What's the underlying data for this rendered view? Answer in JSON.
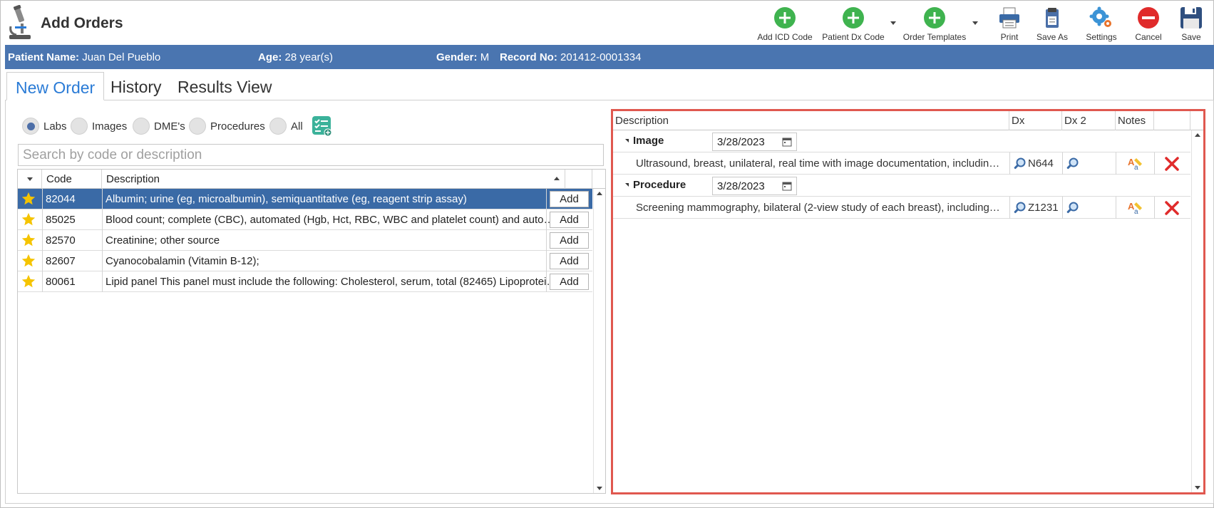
{
  "app": {
    "title": "Add Orders"
  },
  "toolbar": {
    "add_icd_code": "Add ICD Code",
    "patient_dx_code": "Patient Dx Code",
    "order_templates": "Order Templates",
    "print": "Print",
    "save_as": "Save As",
    "settings": "Settings",
    "cancel": "Cancel",
    "save": "Save"
  },
  "patient": {
    "name_label": "Patient Name:",
    "name": "Juan Del Pueblo",
    "age_label": "Age:",
    "age": "28 year(s)",
    "gender_label": "Gender:",
    "gender": "M",
    "record_label": "Record No:",
    "record": "201412-0001334"
  },
  "tabs": [
    {
      "label": "New Order",
      "active": true
    },
    {
      "label": "History",
      "active": false
    },
    {
      "label": "Results View",
      "active": false
    }
  ],
  "filters": [
    {
      "label": "Labs",
      "checked": true
    },
    {
      "label": "Images",
      "checked": false
    },
    {
      "label": "DME's",
      "checked": false
    },
    {
      "label": "Procedures",
      "checked": false
    },
    {
      "label": "All",
      "checked": false
    }
  ],
  "search": {
    "placeholder": "Search by code or description",
    "value": ""
  },
  "catalog": {
    "columns": [
      "Code",
      "Description"
    ],
    "add_label": "Add",
    "rows": [
      {
        "code": "82044",
        "desc": "Albumin; urine (eg, microalbumin), semiquantitative (eg, reagent strip assay)",
        "selected": true
      },
      {
        "code": "85025",
        "desc": "Blood count; complete (CBC), automated (Hgb, Hct, RBC, WBC and platelet count) and automated differential WBC count",
        "selected": false
      },
      {
        "code": "82570",
        "desc": "Creatinine; other source",
        "selected": false
      },
      {
        "code": "82607",
        "desc": "Cyanocobalamin (Vitamin B-12);",
        "selected": false
      },
      {
        "code": "80061",
        "desc": "Lipid panel This panel must include the following: Cholesterol, serum, total (82465) Lipoprotein, direct measurement",
        "selected": false
      }
    ]
  },
  "orders": {
    "columns": [
      "Description",
      "Dx",
      "Dx 2",
      "Notes"
    ],
    "groups": [
      {
        "name": "Image",
        "date": "3/28/2023",
        "items": [
          {
            "desc": "Ultrasound, breast, unilateral, real time with image documentation, including axilla when performed; complete",
            "dx": "N644",
            "dx2": ""
          }
        ]
      },
      {
        "name": "Procedure",
        "date": "3/28/2023",
        "items": [
          {
            "desc": "Screening mammography, bilateral (2-view study of each breast), including computer-aided detection (CAD) when performed",
            "dx": "Z1231",
            "dx2": ""
          }
        ]
      }
    ]
  },
  "colors": {
    "patient_bar": "#4a75b0",
    "selected_row": "#3a6aa6",
    "active_tab": "#2a7bd6",
    "highlight_border": "#e0584f",
    "delete": "#e02b2b",
    "add_green": "#3fb34f"
  }
}
